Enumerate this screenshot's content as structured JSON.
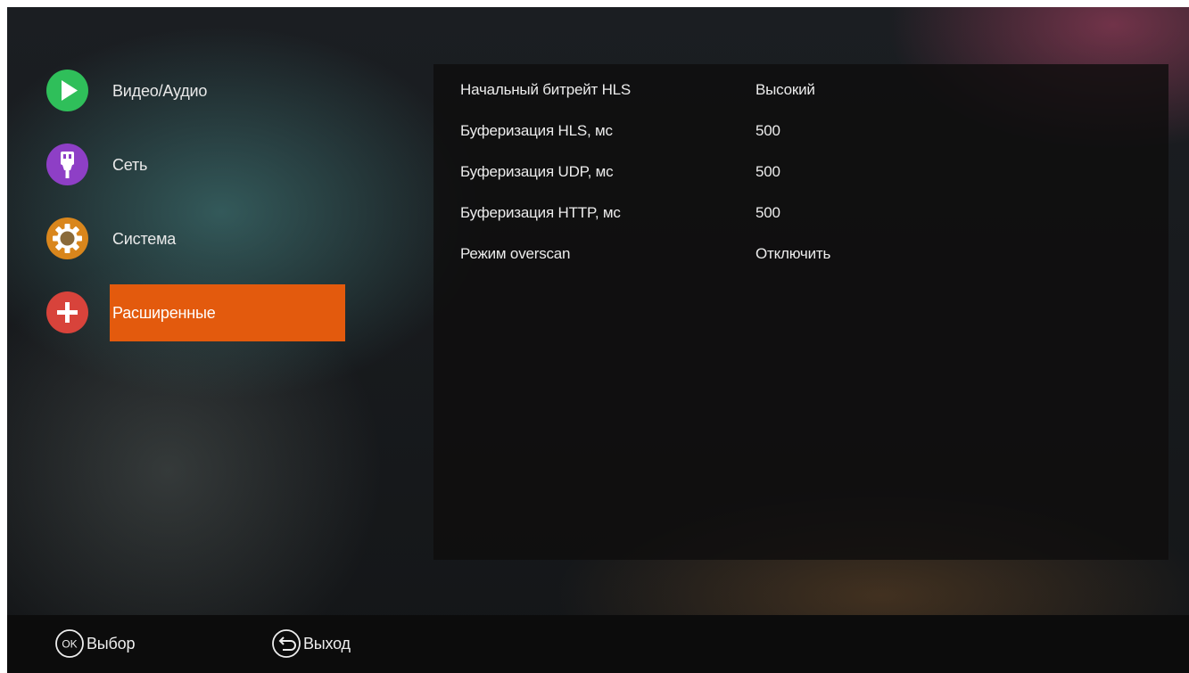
{
  "menu": {
    "items": [
      {
        "label": "Видео/Аудио",
        "icon": "play-icon",
        "color": "#2fbf5a"
      },
      {
        "label": "Сеть",
        "icon": "network-plug-icon",
        "color": "#8e3fc6"
      },
      {
        "label": "Система",
        "icon": "gear-icon",
        "color": "#d9861c"
      },
      {
        "label": "Расширенные",
        "icon": "plus-icon",
        "color": "#d8433b"
      }
    ],
    "active_index": 3,
    "active_color": "#e35a0d"
  },
  "settings": {
    "rows": [
      {
        "label": "Начальный битрейт HLS",
        "value": "Высокий"
      },
      {
        "label": "Буферизация HLS, мс",
        "value": "500"
      },
      {
        "label": "Буферизация UDP, мс",
        "value": "500"
      },
      {
        "label": "Буферизация HTTP, мс",
        "value": "500"
      },
      {
        "label": "Режим overscan",
        "value": "Отключить"
      }
    ]
  },
  "footer": {
    "ok_icon_text": "OK",
    "ok_label": "Выбор",
    "back_label": "Выход"
  }
}
